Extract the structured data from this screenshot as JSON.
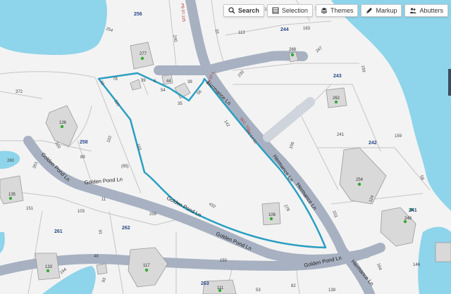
{
  "toolbar": {
    "search": "Search",
    "selection": "Selection",
    "themes": "Themes",
    "markup": "Markup",
    "abutters": "Abutters"
  },
  "parcels": {
    "p256": "256",
    "p277": "277",
    "p244": "244",
    "p268": "268",
    "p243": "243",
    "p262a": "262",
    "p136": "136",
    "p258": "258",
    "p242": "242",
    "p254": "254",
    "p135": "135",
    "p261": "261",
    "p262b": "262",
    "p241": "241",
    "p248": "248",
    "p106": "106",
    "p133": "133",
    "p117": "117",
    "p263": "263",
    "p111": "111"
  },
  "dims": {
    "d254": "254",
    "d240": "240",
    "d21": "21",
    "d22": "22",
    "d33": "33",
    "d113": "113",
    "d163": "163",
    "d247": "247",
    "d372": "372",
    "d10": "10",
    "d78": "78",
    "d39": "39",
    "d6": "6",
    "d44": "44",
    "d38": "38",
    "d54": "54",
    "d56": "56",
    "d35": "35",
    "d230": "230",
    "d159a": "159",
    "d110a": "110",
    "d142": "142",
    "d100": "100",
    "d89": "89",
    "d110b": "110",
    "d110c": "110",
    "d95": "(95)",
    "d241": "241",
    "d159b": "159",
    "d156": "156",
    "d260": "260",
    "d351": "351",
    "d58": "58",
    "d151": "151",
    "d103": "103",
    "d11": "11",
    "d259": "259",
    "d432": "432",
    "d278": "278",
    "d153": "153",
    "d124": "124",
    "d91": "91",
    "d48": "48",
    "d194": "194",
    "d150": "150",
    "d82": "82",
    "d164": "164",
    "d146": "146",
    "d93": "93",
    "d53": "53",
    "d139": "139"
  },
  "plats": {
    "pb_top": "PB 57-125",
    "pb_a": "PB 57-1..",
    "sec": "SEC. 511",
    "pb_b": "PB 14-51"
  },
  "roads": {
    "hermance_ln_a": "Hermance Ln",
    "hermance_ln_b": "Hermance Ln",
    "hermance_ln_c": "Hermance Ln",
    "hermance_ln_d": "Hermance Ln",
    "golden_pond_a": "Golden Pond Ln",
    "golden_pond_b": "Golden Pond Ln",
    "golden_pond_c": "Golden Pond Ln",
    "golden_pond_d": "Golden Pond Ln",
    "golden_pond_e": "Golden Pond Ln",
    "golden_pond_f": "Golden Pond Ln"
  },
  "colors": {
    "water": "#8ed4ea",
    "road": "#a7b1c1",
    "parcel_line": "#c5c5c5",
    "highlight": "#2b9fc1",
    "building": "#d9d9d9",
    "marker": "#33aa33",
    "parcel_id": "#2a4a8a",
    "plat_text": "#b03030"
  }
}
